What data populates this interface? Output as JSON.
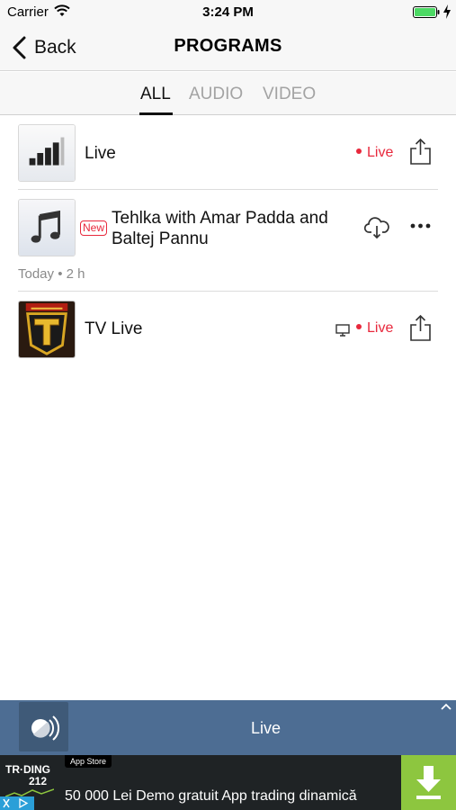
{
  "status_bar": {
    "carrier": "Carrier",
    "time": "3:24 PM"
  },
  "nav": {
    "back_label": "Back",
    "title": "PROGRAMS"
  },
  "tabs": [
    {
      "label": "ALL",
      "selected": true
    },
    {
      "label": "AUDIO",
      "selected": false
    },
    {
      "label": "VIDEO",
      "selected": false
    }
  ],
  "programs": [
    {
      "title": "Live",
      "status": "Live",
      "action_icon": "share-icon"
    },
    {
      "badge": "New",
      "title_line1": "Tehlka with Amar Padda and",
      "title_line2": "Baltej Pannu",
      "meta": "Today • 2 h",
      "actions": [
        "download-cloud-icon",
        "more-icon"
      ]
    },
    {
      "title": "TV Live",
      "status": "Live",
      "extra_icon": "tv-icon",
      "action_icon": "share-icon"
    }
  ],
  "mini_player": {
    "title": "Live"
  },
  "ad": {
    "brand_line1": "TR·DING",
    "brand_line2": "212",
    "store_badge": "App Store",
    "text": "50 000 Lei Demo gratuit App trading dinamică"
  },
  "colors": {
    "accent_live": "#e8283c",
    "player_bg": "#4d6d93",
    "ad_download": "#8dc63f"
  }
}
